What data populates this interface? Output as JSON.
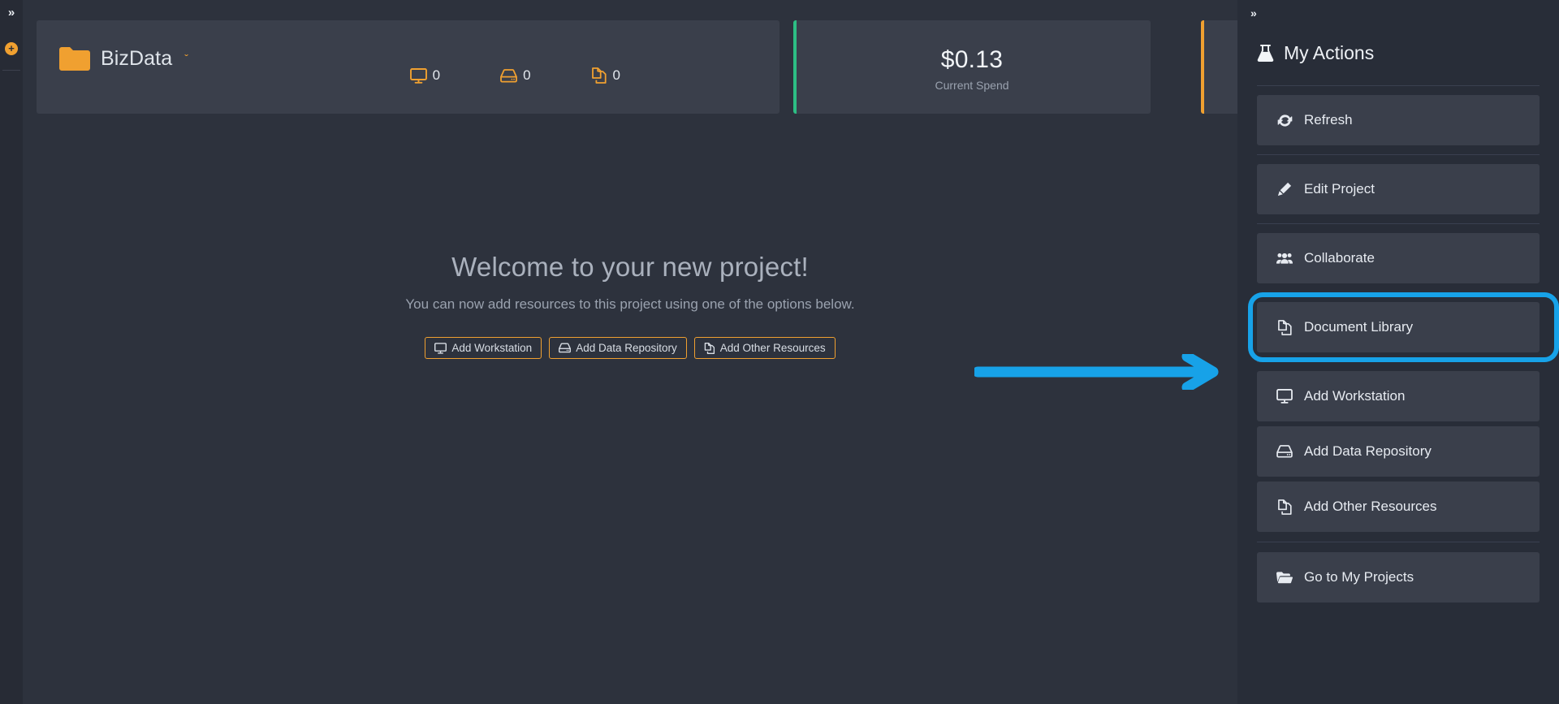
{
  "colors": {
    "page_bg": "#2d323d",
    "rail_bg": "#272b35",
    "card_bg": "#3a3f4b",
    "panel_bg": "#282d38",
    "accent_orange": "#f0a030",
    "accent_green": "#2dbe84",
    "highlight_blue": "#17a2e8",
    "text_primary": "#e7ebf1",
    "text_muted": "#9aa2af"
  },
  "left_rail": {
    "expand_label": "»",
    "add_label": "+"
  },
  "project_card": {
    "name": "BizData",
    "dropdown_caret": "ˇ",
    "folder_icon": "folder-icon",
    "stats": [
      {
        "icon": "workstation-icon",
        "count": "0"
      },
      {
        "icon": "data-repository-icon",
        "count": "0"
      },
      {
        "icon": "other-resources-icon",
        "count": "0"
      }
    ]
  },
  "metric_cards": [
    {
      "value": "$0.13",
      "label": "Current Spend",
      "accent": "#2dbe84"
    },
    {
      "value": "",
      "label": "",
      "accent": "#f0a030"
    }
  ],
  "welcome": {
    "title": "Welcome to your new project!",
    "subtitle": "You can now add resources to this project using one of the options below.",
    "buttons": [
      {
        "label": "Add Workstation",
        "icon": "workstation-icon"
      },
      {
        "label": "Add Data Repository",
        "icon": "data-repository-icon"
      },
      {
        "label": "Add Other Resources",
        "icon": "other-resources-icon"
      }
    ]
  },
  "right_panel": {
    "collapse_label": "»",
    "title": "My Actions",
    "title_icon": "flask-icon",
    "items": [
      {
        "label": "Refresh",
        "icon": "refresh-icon",
        "highlighted": false
      },
      {
        "label": "Edit Project",
        "icon": "pencil-icon",
        "highlighted": false
      },
      {
        "label": "Collaborate",
        "icon": "users-icon",
        "highlighted": false
      },
      {
        "label": "Document Library",
        "icon": "document-library-icon",
        "highlighted": true
      },
      {
        "label": "Add Workstation",
        "icon": "workstation-icon",
        "highlighted": false
      },
      {
        "label": "Add Data Repository",
        "icon": "data-repository-icon",
        "highlighted": false
      },
      {
        "label": "Add Other Resources",
        "icon": "other-resources-icon",
        "highlighted": false
      },
      {
        "label": "Go to My Projects",
        "icon": "open-folder-icon",
        "highlighted": false
      }
    ]
  },
  "annotation": {
    "type": "arrow",
    "color": "#17a2e8",
    "direction": "right",
    "points_to": "Document Library"
  }
}
